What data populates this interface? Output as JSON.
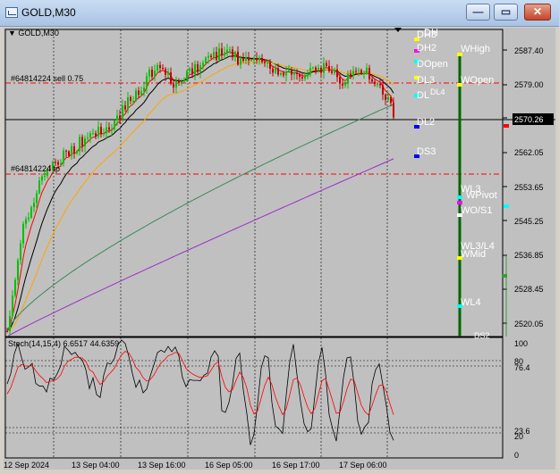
{
  "window": {
    "title": "GOLD,M30"
  },
  "chart": {
    "header": "▼ GOLD,M30",
    "trade_lines": [
      {
        "label": "#64814224 sell 0.75"
      },
      {
        "label": "#64814224 tp"
      }
    ],
    "price_axis": [
      "2587.40",
      "2579.00",
      "2562.05",
      "2553.65",
      "2545.25",
      "2536.85",
      "2528.45",
      "2520.05"
    ],
    "current_price": "2570.26",
    "time_axis": [
      "12 Sep 2024",
      "13 Sep 04:00",
      "13 Sep 16:00",
      "16 Sep 05:00",
      "16 Sep 17:00",
      "17 Sep 06:00"
    ],
    "daily_labels": [
      "DH3",
      "DH",
      "DH2",
      "DOpen",
      "DL3",
      "DL",
      "DL2",
      "DS3",
      "DL4",
      "DS2"
    ],
    "weekly_labels": [
      "WHigh",
      "WOpen",
      "WL3",
      "WPivot",
      "WO/S1",
      "WL3/L4",
      "WMid",
      "WL4"
    ],
    "stoch": {
      "label": "Stoch(14,15,4) 6.6517 44.6359",
      "axis": [
        "100",
        "80",
        "76.4",
        "23.6",
        "20",
        "0"
      ]
    },
    "colors": {
      "background": "#c0c0c0",
      "candle_up": "#00c000",
      "candle_down": "#c00000",
      "trade_line": "#ff0000",
      "current_price_label": "#000000"
    }
  }
}
